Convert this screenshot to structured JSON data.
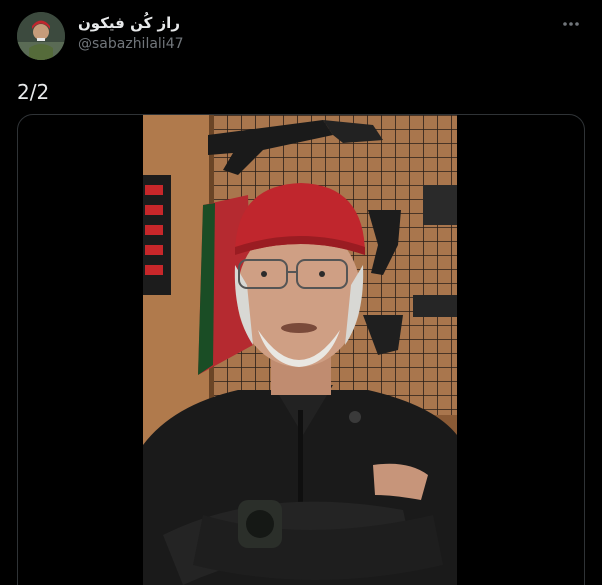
{
  "tweet": {
    "display_name": "راز کُن فیکون",
    "handle": "@sabazhilali47",
    "text": "2/2",
    "more_icon": "more-horizontal-icon",
    "media_type": "video"
  },
  "colors": {
    "background": "#000000",
    "text_primary": "#e7e9ea",
    "text_secondary": "#71767b",
    "border": "#2f3336"
  }
}
